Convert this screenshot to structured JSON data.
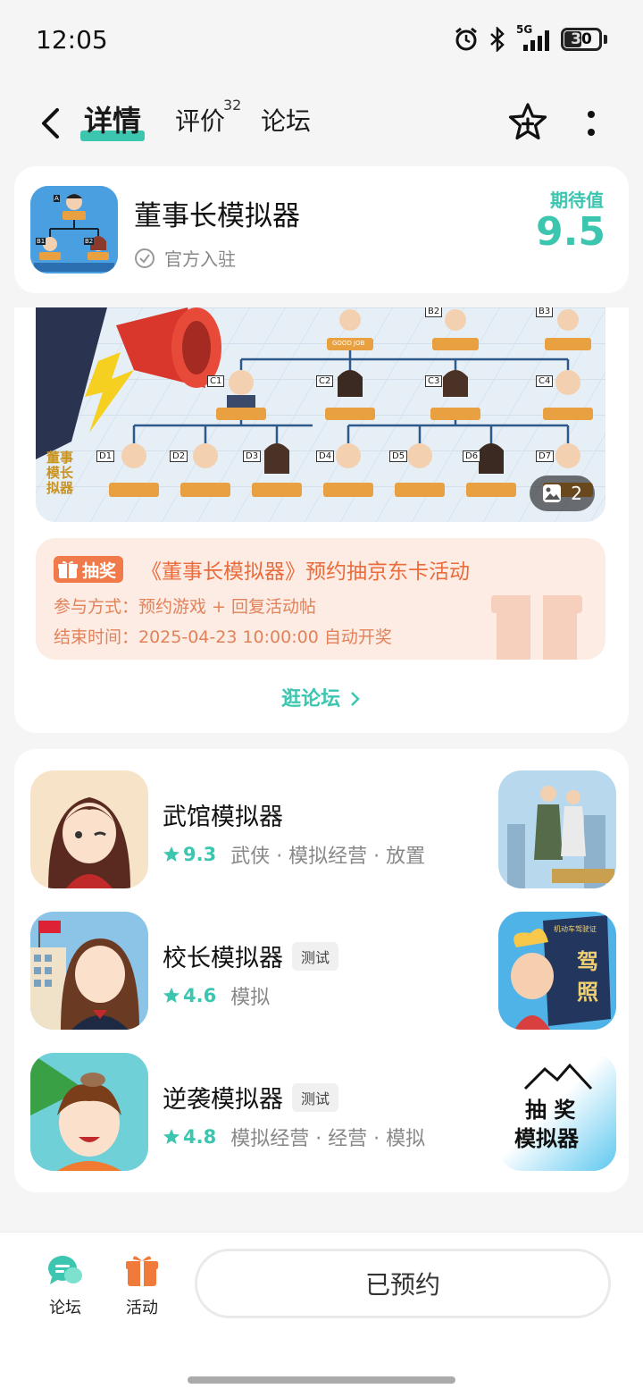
{
  "status_bar": {
    "time": "12:05",
    "network": "5G",
    "battery": "30"
  },
  "nav": {
    "tabs": [
      {
        "label": "详情"
      },
      {
        "label": "评价"
      },
      {
        "label": "论坛"
      }
    ],
    "review_count": "32"
  },
  "game": {
    "title": "董事长模拟器",
    "official_label": "官方入驻",
    "expect_label": "期待值",
    "expect_score": "9.5",
    "icon_badges": [
      "A",
      "B1",
      "B2"
    ]
  },
  "banner": {
    "image_count": "2",
    "node_labels": [
      "C1",
      "C2",
      "C3",
      "C4",
      "D1",
      "D2",
      "D3",
      "D4",
      "D5",
      "D6",
      "D7"
    ],
    "top_labels": [
      "B2",
      "B3"
    ],
    "nameplate": "GOOD JOB",
    "side_title": "董事模长拟器"
  },
  "lottery": {
    "tag": "抽奖",
    "title": "《董事长模拟器》预约抽京东卡活动",
    "method": "参与方式：预约游戏 + 回复活动帖",
    "end_time": "结束时间：2025-04-23 10:00:00 自动开奖"
  },
  "forum_link": "逛论坛",
  "recommendations": [
    {
      "name": "武馆模拟器",
      "tag": "",
      "score": "9.3",
      "genres": "武侠 · 模拟经营 · 放置"
    },
    {
      "name": "校长模拟器",
      "tag": "测试",
      "score": "4.6",
      "genres": "模拟"
    },
    {
      "name": "逆袭模拟器",
      "tag": "测试",
      "score": "4.8",
      "genres": "模拟经营 · 经营 · 模拟"
    }
  ],
  "thumb_texts": {
    "license_1": "驾",
    "license_2": "照",
    "license_header": "机动车驾驶证",
    "lottery_sim_1": "抽 奖",
    "lottery_sim_2": "模拟器"
  },
  "bottom_bar": {
    "forum_label": "论坛",
    "activity_label": "活动",
    "reserved_label": "已预约"
  },
  "colors": {
    "accent": "#3cc6b0",
    "lottery": "#ea6b3b",
    "lottery_bg": "#fdece3"
  }
}
